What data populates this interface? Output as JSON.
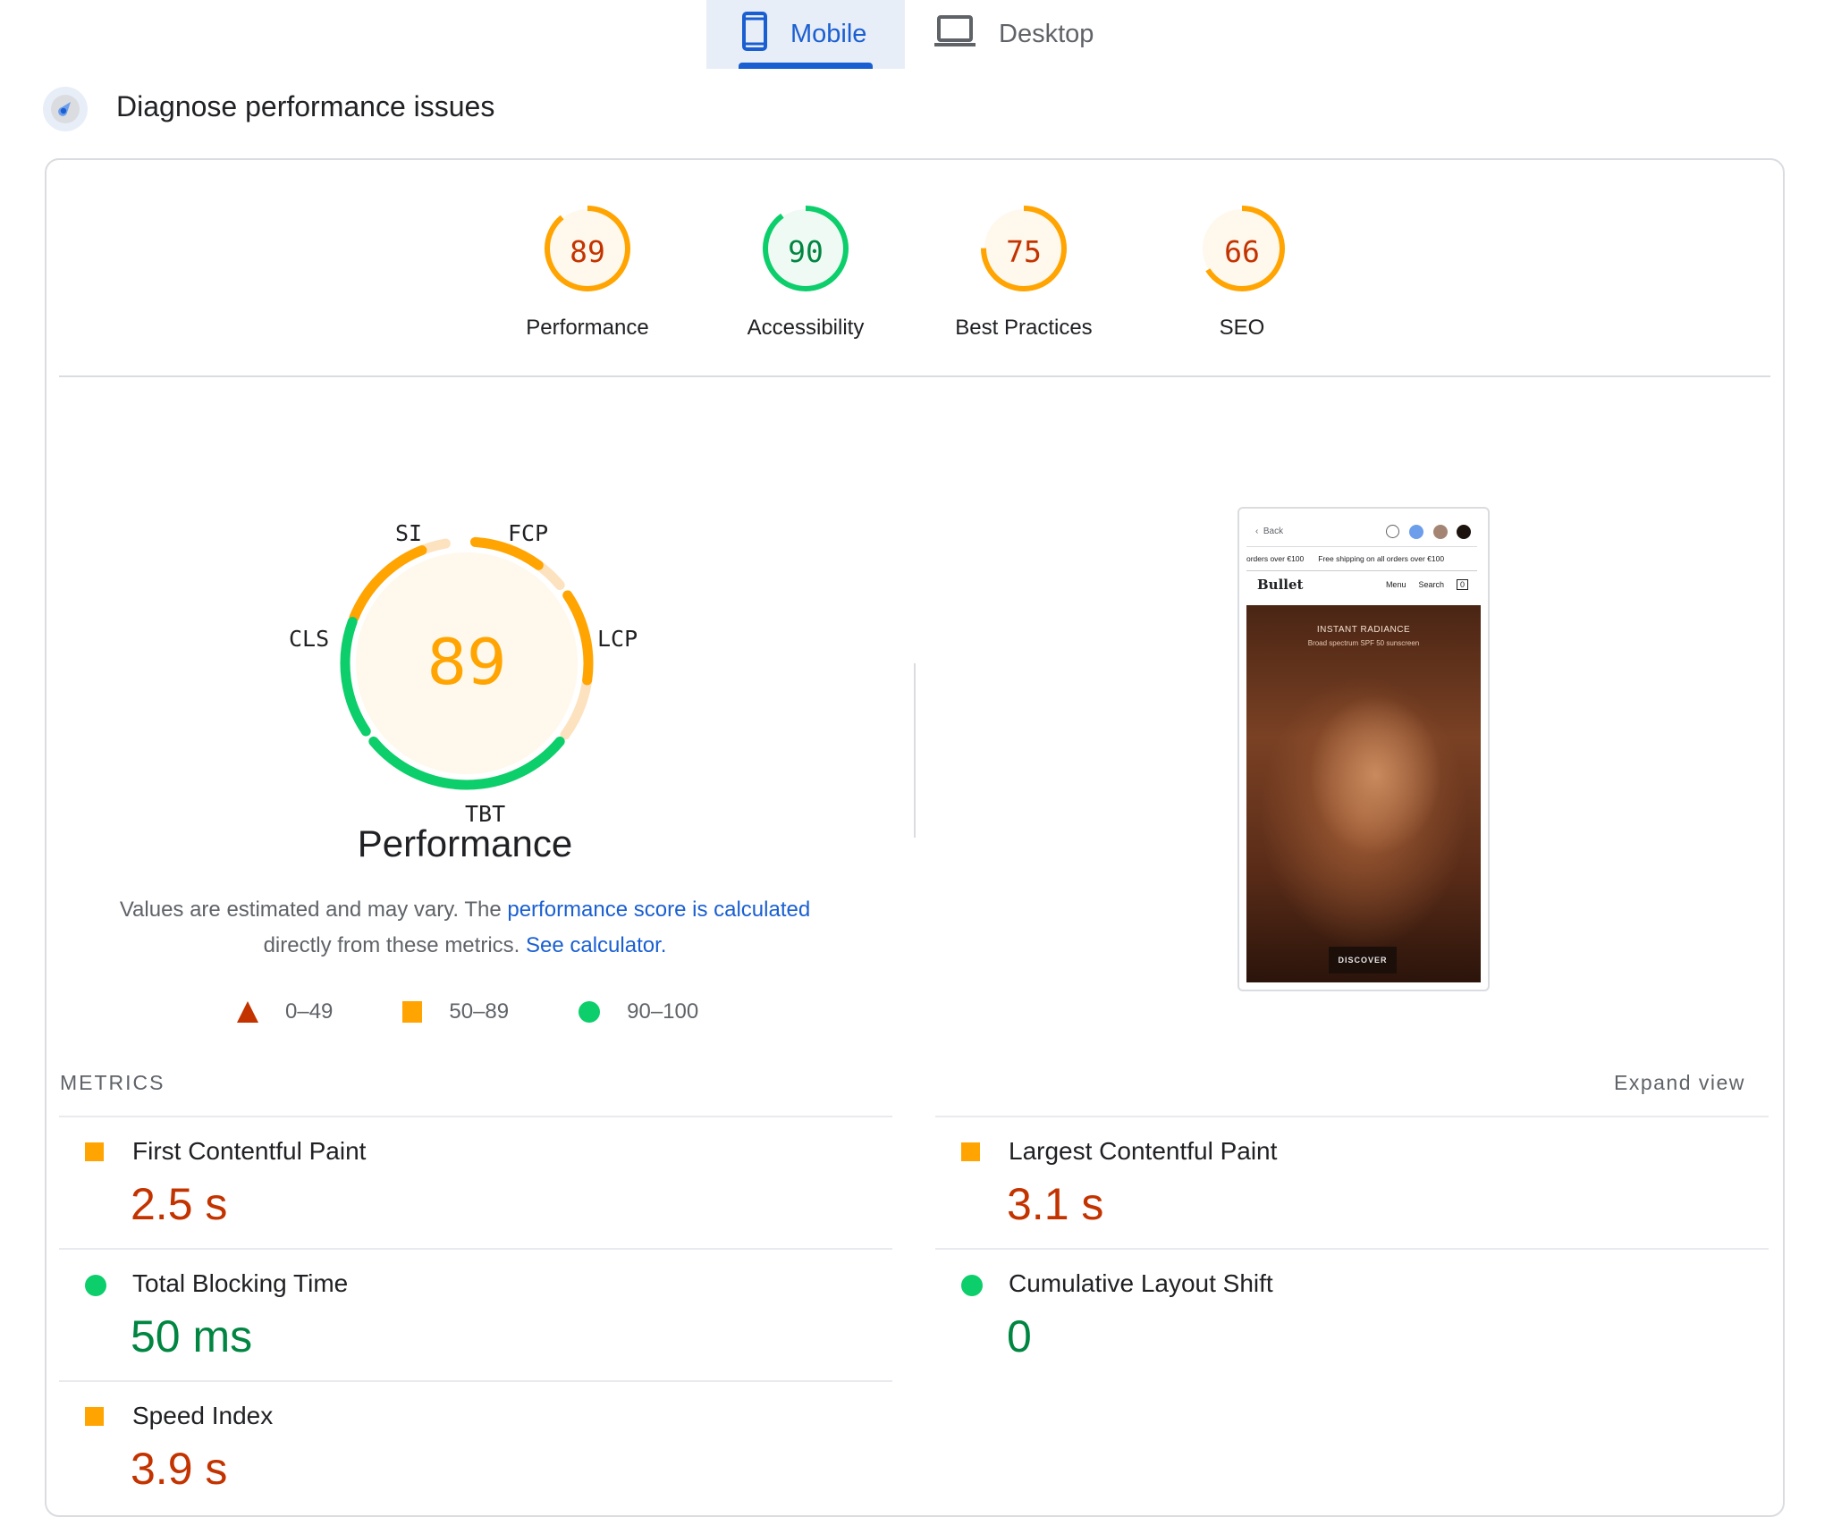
{
  "tabs": [
    {
      "label": "Mobile",
      "icon": "smartphone-icon",
      "selected": true
    },
    {
      "label": "Desktop",
      "icon": "laptop-icon",
      "selected": false
    }
  ],
  "header": {
    "title": "Diagnose performance issues",
    "icon": "lighthouse-gauge-icon"
  },
  "colors": {
    "accent": "#1a5fd1",
    "average": "#ffa400",
    "pass": "#0cce6b",
    "fail": "#c33300",
    "pass_text": "#018642"
  },
  "categories": [
    {
      "label": "Performance",
      "score": 89,
      "rating": "average"
    },
    {
      "label": "Accessibility",
      "score": 90,
      "rating": "pass"
    },
    {
      "label": "Best Practices",
      "score": 75,
      "rating": "average"
    },
    {
      "label": "SEO",
      "score": 66,
      "rating": "average"
    }
  ],
  "performance": {
    "score": 89,
    "title": "Performance",
    "gauge_segments": [
      {
        "label": "SI",
        "rating": "average",
        "fill": 0.8
      },
      {
        "label": "FCP",
        "rating": "average",
        "fill": 0.7
      },
      {
        "label": "LCP",
        "rating": "average",
        "fill": 0.6
      },
      {
        "label": "TBT",
        "rating": "pass",
        "fill": 1.0
      },
      {
        "label": "CLS",
        "rating": "pass",
        "fill": 1.0
      }
    ],
    "description_prefix": "Values are estimated and may vary. The ",
    "description_link1": "performance score is calculated",
    "description_middle": " directly from these metrics. ",
    "description_link2": "See calculator."
  },
  "legend": [
    {
      "shape": "triangle",
      "range": "0–49"
    },
    {
      "shape": "square",
      "range": "50–89"
    },
    {
      "shape": "circle",
      "range": "90–100"
    }
  ],
  "screenshot": {
    "back_label": "Back",
    "banner_left": "orders over €100",
    "banner_right": "Free shipping on all orders over €100",
    "brand": "Bullet",
    "nav_menu": "Menu",
    "nav_search": "Search",
    "cart_count": "0",
    "hero_heading": "INSTANT RADIANCE",
    "hero_sub": "Broad spectrum SPF 50 sunscreen",
    "hero_button": "DISCOVER",
    "swatches": [
      "#f1f3f4",
      "#6d9eeb",
      "#a48574",
      "#1c120e"
    ]
  },
  "metrics": {
    "heading": "METRICS",
    "expand_label": "Expand view",
    "items": [
      {
        "label": "First Contentful Paint",
        "value": "2.5 s",
        "rating": "average"
      },
      {
        "label": "Largest Contentful Paint",
        "value": "3.1 s",
        "rating": "average"
      },
      {
        "label": "Total Blocking Time",
        "value": "50 ms",
        "rating": "pass"
      },
      {
        "label": "Cumulative Layout Shift",
        "value": "0",
        "rating": "pass"
      },
      {
        "label": "Speed Index",
        "value": "3.9 s",
        "rating": "average"
      }
    ]
  }
}
